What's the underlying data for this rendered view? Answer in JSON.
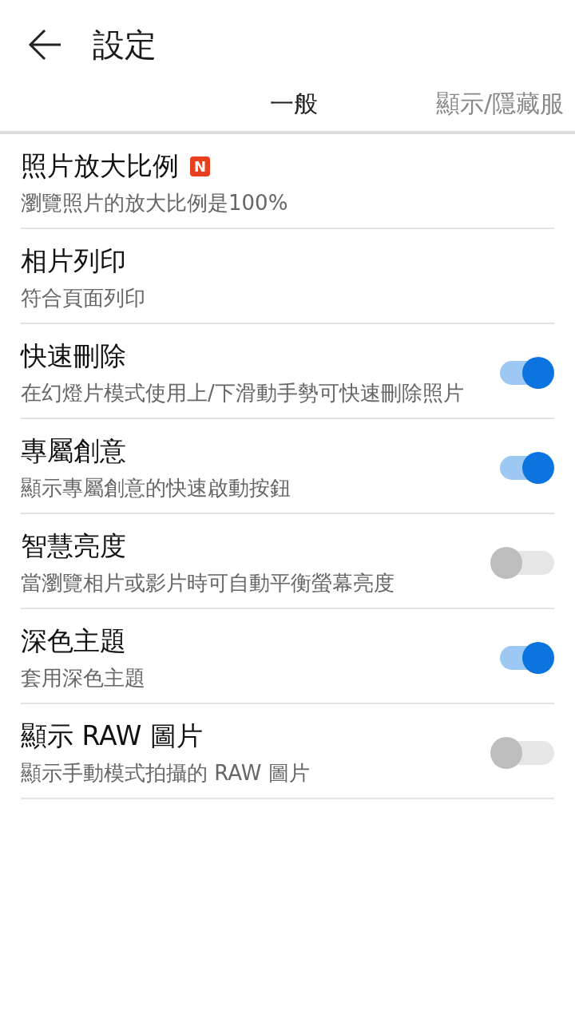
{
  "header": {
    "title": "設定"
  },
  "tabs": [
    {
      "label": "一般",
      "selected": true
    },
    {
      "label": "顯示/隱藏服",
      "selected": false
    }
  ],
  "settings": [
    {
      "kind": "text",
      "title": "照片放大比例",
      "badge": "N",
      "subtitle": "瀏覽照片的放大比例是100%"
    },
    {
      "kind": "text",
      "title": "相片列印",
      "subtitle": "符合頁面列印"
    },
    {
      "kind": "toggle",
      "title": "快速刪除",
      "subtitle": "在幻燈片模式使用上/下滑動手勢可快速刪除照片",
      "on": true
    },
    {
      "kind": "toggle",
      "title": "專屬創意",
      "subtitle": "顯示專屬創意的快速啟動按鈕",
      "on": true
    },
    {
      "kind": "toggle",
      "title": "智慧亮度",
      "subtitle": "當瀏覽相片或影片時可自動平衡螢幕亮度",
      "on": false
    },
    {
      "kind": "toggle",
      "title": "深色主題",
      "subtitle": "套用深色主題",
      "on": true
    },
    {
      "kind": "toggle",
      "title": "顯示 RAW 圖片",
      "subtitle": "顯示手動模式拍攝的 RAW 圖片",
      "on": false
    }
  ]
}
